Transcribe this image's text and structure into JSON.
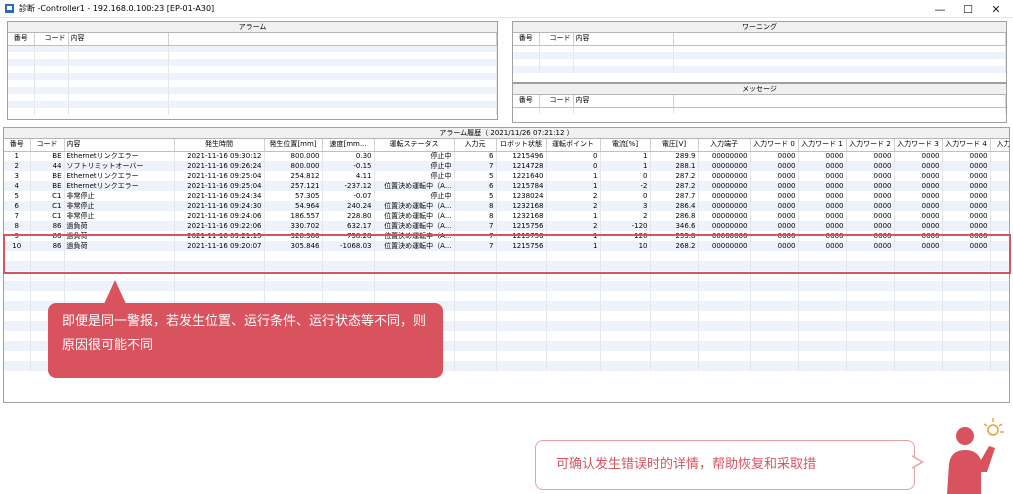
{
  "window": {
    "title": "診断 -Controller1 - 192.168.0.100:23 [EP-01-A30]",
    "minimize": "—",
    "maximize": "☐",
    "close": "✕"
  },
  "alarm_panel": {
    "title": "アラーム",
    "columns": [
      "番号",
      "コード",
      "内容"
    ]
  },
  "warning_panel": {
    "title": "ワーニング",
    "columns": [
      "番号",
      "コード",
      "内容"
    ]
  },
  "message_panel": {
    "title": "メッセージ",
    "columns": [
      "番号",
      "コード",
      "内容"
    ]
  },
  "history": {
    "title": "アラーム履歴（ 2021/11/26 07:21:12 ）",
    "columns": [
      "番号",
      "コード",
      "内容",
      "発生時間",
      "発生位置[mm]",
      "速度[mm...",
      "運転ステータス",
      "入力元",
      "ロボット状態",
      "運転ポイント",
      "電流[%]",
      "電圧[V]",
      "入力端子",
      "入力ワード 0",
      "入力ワード 1",
      "入力ワード 2",
      "入力ワード 3",
      "入力ワード 4",
      "入力ワー"
    ],
    "rows": [
      [
        "1",
        "BE",
        "Ethernetリンクエラー",
        "2021-11-16 09:30:12",
        "800.000",
        "0.30",
        "停止中",
        "6",
        "1215496",
        "0",
        "1",
        "289.9",
        "00000000",
        "0000",
        "0000",
        "0000",
        "0000",
        "0000",
        "00"
      ],
      [
        "2",
        "44",
        "ソフトリミットオーバー",
        "2021-11-16 09:26:24",
        "800.000",
        "-0.15",
        "停止中",
        "7",
        "1214728",
        "0",
        "1",
        "288.1",
        "00000000",
        "0000",
        "0000",
        "0000",
        "0000",
        "0000",
        "00"
      ],
      [
        "3",
        "BE",
        "Ethernetリンクエラー",
        "2021-11-16 09:25:04",
        "254.812",
        "4.11",
        "停止中",
        "5",
        "1221640",
        "1",
        "0",
        "287.2",
        "00000000",
        "0000",
        "0000",
        "0000",
        "0000",
        "0000",
        "00"
      ],
      [
        "4",
        "BE",
        "Ethernetリンクエラー",
        "2021-11-16 09:25:04",
        "257.121",
        "-237.12",
        "位置決め運転中（A...",
        "6",
        "1215784",
        "1",
        "-2",
        "287.2",
        "00000000",
        "0000",
        "0000",
        "0000",
        "0000",
        "0000",
        "00"
      ],
      [
        "5",
        "C1",
        "非常停止",
        "2021-11-16 09:24:34",
        "57.305",
        "-0.07",
        "停止中",
        "5",
        "1238024",
        "2",
        "0",
        "287.7",
        "00000000",
        "0000",
        "0000",
        "0000",
        "0000",
        "0000",
        "00"
      ],
      [
        "6",
        "C1",
        "非常停止",
        "2021-11-16 09:24:30",
        "54.964",
        "240.24",
        "位置決め運転中（A...",
        "8",
        "1232168",
        "2",
        "3",
        "286.4",
        "00000000",
        "0000",
        "0000",
        "0000",
        "0000",
        "0000",
        "00"
      ],
      [
        "7",
        "C1",
        "非常停止",
        "2021-11-16 09:24:06",
        "186.557",
        "228.80",
        "位置決め運転中（A...",
        "8",
        "1232168",
        "1",
        "2",
        "286.8",
        "00000000",
        "0000",
        "0000",
        "0000",
        "0000",
        "0000",
        "00"
      ],
      [
        "8",
        "86",
        "過負荷",
        "2021-11-16 09:22:06",
        "330.702",
        "632.17",
        "位置決め運転中（A...",
        "7",
        "1215756",
        "2",
        "-120",
        "346.6",
        "00000000",
        "0000",
        "0000",
        "0000",
        "0000",
        "0000",
        "00"
      ],
      [
        "9",
        "86",
        "過負荷",
        "2021-11-16 09:21:15",
        "328.586",
        "-758.28",
        "位置決め運転中（A...",
        "7",
        "1215756",
        "1",
        "120",
        "255.8",
        "00000000",
        "0000",
        "0000",
        "0000",
        "0000",
        "0000",
        "00"
      ],
      [
        "10",
        "86",
        "過負荷",
        "2021-11-16 09:20:07",
        "305.846",
        "-1068.03",
        "位置決め運転中（A...",
        "7",
        "1215756",
        "1",
        "10",
        "268.2",
        "00000000",
        "0000",
        "0000",
        "0000",
        "0000",
        "0000",
        "00"
      ]
    ]
  },
  "callout": {
    "text": "即便是同一警报，若发生位置、运行条件、运行状态等不同，则原因很可能不同"
  },
  "note": {
    "text": "可确认发生错误时的详情，帮助恢复和采取措"
  },
  "colors": {
    "accent_red": "#d9535f",
    "stripe_blue": "#eef3fb"
  },
  "icons": {
    "app": "robot-app-icon",
    "person": "person-idea-icon"
  }
}
